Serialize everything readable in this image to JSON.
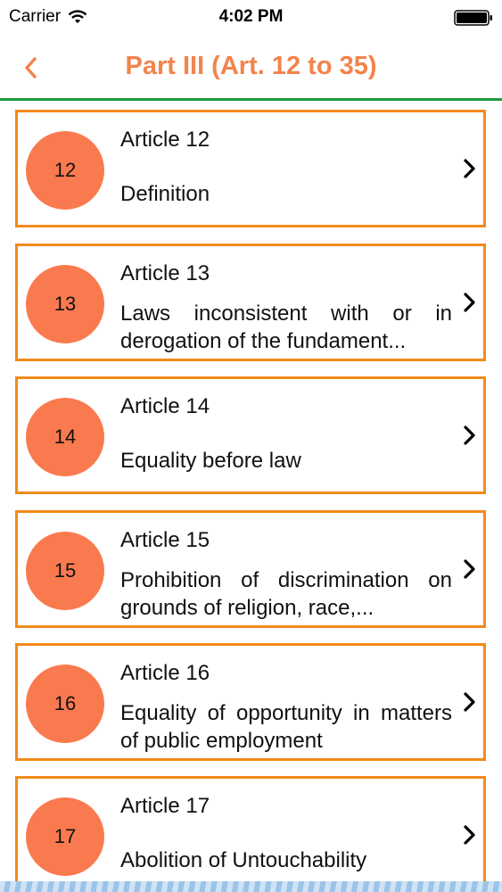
{
  "status_bar": {
    "carrier": "Carrier",
    "time": "4:02 PM"
  },
  "nav": {
    "title": "Part III (Art. 12 to 35)",
    "accent_color": "#f2844c",
    "divider_color": "#1e9a3a"
  },
  "articles": [
    {
      "number": "12",
      "title": "Article 12",
      "description": "Definition"
    },
    {
      "number": "13",
      "title": "Article 13",
      "description": "Laws inconsistent with or in derogation of the fundament..."
    },
    {
      "number": "14",
      "title": "Article 14",
      "description": "Equality before law"
    },
    {
      "number": "15",
      "title": "Article 15",
      "description": "Prohibition of discrimination on grounds of religion, race,..."
    },
    {
      "number": "16",
      "title": "Article 16",
      "description": "Equality of opportunity in matters of public employment"
    },
    {
      "number": "17",
      "title": "Article 17",
      "description": "Abolition of Untouchability"
    }
  ],
  "colors": {
    "card_border": "#f28a1c",
    "circle_fill": "#fa7a4f"
  }
}
